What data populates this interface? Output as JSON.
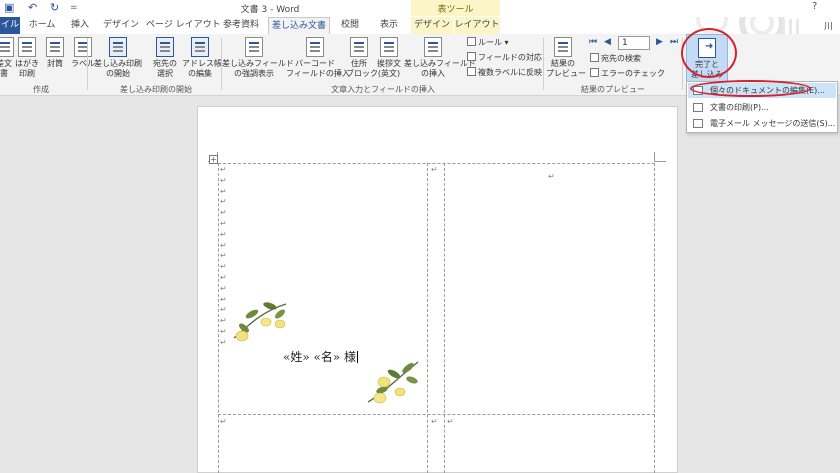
{
  "window": {
    "title": "文書 3 - Word",
    "table_tools_label": "表ツール",
    "help": "?",
    "user": "川中"
  },
  "quick_access": {
    "save_icon": "save-icon",
    "undo_icon": "undo-icon",
    "redo_icon": "redo-icon",
    "customize": "="
  },
  "tabs": [
    "イル",
    "ホーム",
    "挿入",
    "デザイン",
    "ページ レイアウト",
    "参考資料",
    "差し込み文書",
    "校閲",
    "表示",
    "デザイン",
    "レイアウト"
  ],
  "ribbon": {
    "create": {
      "label": "作成",
      "buttons": [
        "差文\n書",
        "はがき\n印刷",
        "封筒",
        "ラベル"
      ]
    },
    "start_merge": {
      "label": "差し込み印刷の開始",
      "buttons": [
        "差し込み印刷\nの開始",
        "宛先の\n選択",
        "アドレス帳\nの編集"
      ]
    },
    "write_insert": {
      "label": "文章入力とフィールドの挿入",
      "buttons": [
        "差し込みフィールド\nの強調表示",
        "バーコード\nフィールドの挿入",
        "住所\nブロック",
        "挨拶文\n(英文)",
        "差し込みフィールド\nの挿入"
      ],
      "small": [
        "ルール",
        "フィールドの対応",
        "複数ラベルに反映"
      ]
    },
    "preview": {
      "label": "結果のプレビュー",
      "button": "結果の\nプレビュー",
      "record": "1",
      "small": [
        "宛先の検索",
        "エラーのチェック"
      ]
    },
    "finish": {
      "button": "完了と\n差し込み"
    }
  },
  "finish_menu": {
    "items": [
      {
        "label": "個々のドキュメントの編集(E)...",
        "icon": "document-edit-icon"
      },
      {
        "label": "文書の印刷(P)...",
        "icon": "print-icon"
      },
      {
        "label": "電子メール メッセージの送信(S)...",
        "icon": "email-icon"
      }
    ]
  },
  "document": {
    "merge_text": "«姓» «名» 様",
    "table_handle": "+",
    "paragraph_mark": "↵"
  }
}
